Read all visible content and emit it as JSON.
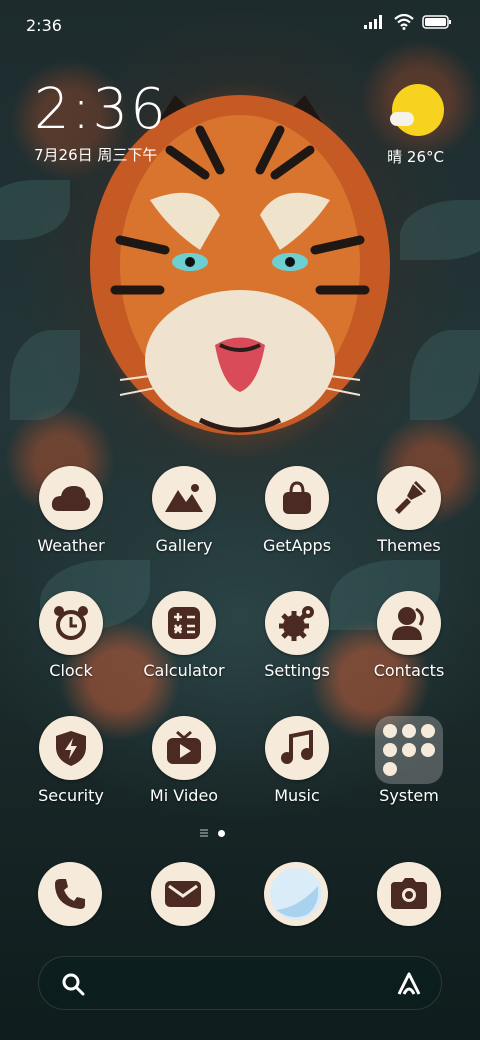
{
  "status_bar": {
    "time": "2:36",
    "icons": [
      "signal-icon",
      "wifi-icon",
      "battery-icon"
    ]
  },
  "clock_widget": {
    "time": "2:36",
    "date": "7月26日 周三下午"
  },
  "weather_widget": {
    "condition_temp": "晴 26°C",
    "icon": "sun-cloud-icon"
  },
  "apps": [
    {
      "label": "Weather",
      "icon": "cloud-icon"
    },
    {
      "label": "Gallery",
      "icon": "mountain-icon"
    },
    {
      "label": "GetApps",
      "icon": "shopping-bag-icon"
    },
    {
      "label": "Themes",
      "icon": "brush-icon"
    },
    {
      "label": "Clock",
      "icon": "alarm-clock-icon"
    },
    {
      "label": "Calculator",
      "icon": "calculator-icon"
    },
    {
      "label": "Settings",
      "icon": "gear-icon"
    },
    {
      "label": "Contacts",
      "icon": "person-icon"
    },
    {
      "label": "Security",
      "icon": "shield-icon"
    },
    {
      "label": "Mi Video",
      "icon": "tv-play-icon"
    },
    {
      "label": "Music",
      "icon": "music-note-icon"
    },
    {
      "label": "System",
      "icon": "folder-icon"
    }
  ],
  "dock": [
    {
      "name": "phone",
      "icon": "phone-icon"
    },
    {
      "name": "messages",
      "icon": "envelope-icon"
    },
    {
      "name": "browser",
      "icon": "browser-icon"
    },
    {
      "name": "camera",
      "icon": "camera-icon"
    }
  ],
  "colors": {
    "icon_bg": "#f6eadb",
    "icon_fg": "#4a2a22",
    "sun": "#f7d21e"
  }
}
